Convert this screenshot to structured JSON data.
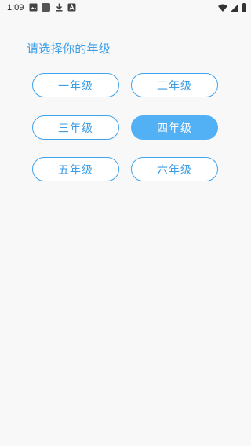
{
  "status_bar": {
    "time": "1:09",
    "icons": [
      "image-notification-icon",
      "app-notification-icon",
      "download-icon",
      "accessibility-notification-icon",
      "wifi-icon",
      "signal-icon",
      "battery-icon"
    ]
  },
  "prompt": "请选择你的年级",
  "grades": [
    {
      "label": "一年级",
      "selected": false
    },
    {
      "label": "二年级",
      "selected": false
    },
    {
      "label": "三年级",
      "selected": false
    },
    {
      "label": "四年级",
      "selected": true
    },
    {
      "label": "五年级",
      "selected": false
    },
    {
      "label": "六年级",
      "selected": false
    }
  ],
  "colors": {
    "accent": "#3fa3ee",
    "selected_fill": "#52b0f5",
    "background": "#f8f8f9"
  }
}
